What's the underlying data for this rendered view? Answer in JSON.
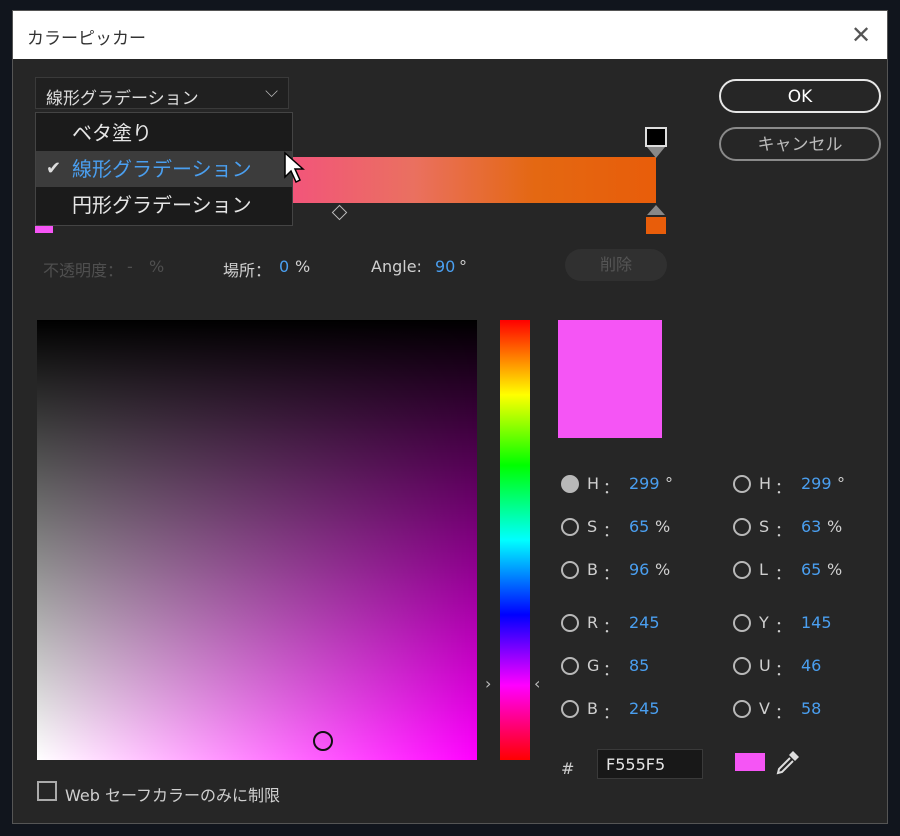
{
  "dialog": {
    "title": "カラーピッカー",
    "close_glyph": "✕"
  },
  "gradient_type": {
    "selected": "線形グラデーション",
    "chevron": "⌵",
    "options": [
      "ベタ塗り",
      "線形グラデーション",
      "円形グラデーション"
    ],
    "selected_index": 1
  },
  "buttons": {
    "ok": "OK",
    "cancel": "キャンセル",
    "delete": "削除"
  },
  "stop": {
    "opacity_label": "不透明度：",
    "opacity_value": "-",
    "opacity_unit": "%",
    "location_label": "場所：",
    "location_value": "0",
    "location_unit": "%",
    "angle_label": "Angle:",
    "angle_value": "90",
    "angle_unit": "°"
  },
  "colors": {
    "current": "#f555f5",
    "gradient_start": "#f2557a",
    "gradient_end": "#e85d0a"
  },
  "values_left": [
    {
      "label": "H",
      "value": "299",
      "unit": "°",
      "selected": true
    },
    {
      "label": "S",
      "value": "65",
      "unit": "%",
      "selected": false
    },
    {
      "label": "B",
      "value": "96",
      "unit": "%",
      "selected": false
    },
    {
      "label": "R",
      "value": "245",
      "unit": "",
      "selected": false
    },
    {
      "label": "G",
      "value": "85",
      "unit": "",
      "selected": false
    },
    {
      "label": "B",
      "value": "245",
      "unit": "",
      "selected": false
    }
  ],
  "values_right": [
    {
      "label": "H",
      "value": "299",
      "unit": "°"
    },
    {
      "label": "S",
      "value": "63",
      "unit": "%"
    },
    {
      "label": "L",
      "value": "65",
      "unit": "%"
    },
    {
      "label": "Y",
      "value": "145",
      "unit": ""
    },
    {
      "label": "U",
      "value": "46",
      "unit": ""
    },
    {
      "label": "V",
      "value": "58",
      "unit": ""
    }
  ],
  "hex": {
    "prefix": "#",
    "value": "F555F5"
  },
  "web_safe": {
    "label": "Web セーフカラーのみに制限",
    "checked": false
  },
  "icons": {
    "close": "close-icon",
    "check": "check-icon",
    "eyedropper": "eyedropper-icon",
    "cursor": "mouse-cursor-icon"
  },
  "glyphs": {
    "colon": "：",
    "check": "✔",
    "hue_left": "›",
    "hue_right": "‹"
  }
}
